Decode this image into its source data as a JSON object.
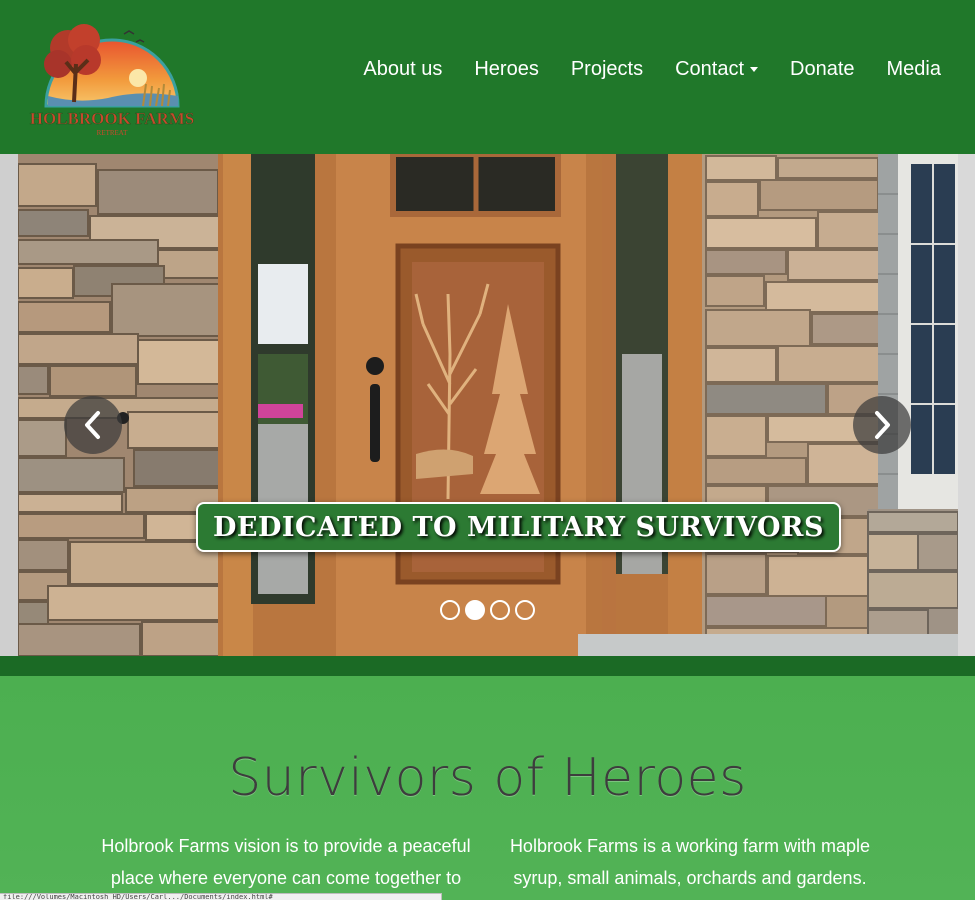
{
  "brand": {
    "logo_text": "HOLBROOK FARMS",
    "logo_subtext": "RETREAT",
    "colors": {
      "nav_bg": "#20782a",
      "section_bg": "#4caf50",
      "caption_bg": "#2c7a33"
    }
  },
  "nav": {
    "items": [
      {
        "label": "About us"
      },
      {
        "label": "Heroes"
      },
      {
        "label": "Projects"
      },
      {
        "label": "Contact"
      },
      {
        "label": "Donate"
      },
      {
        "label": "Media"
      }
    ],
    "dropdown_icon": "caret-down-icon"
  },
  "carousel": {
    "caption": "DEDICATED TO MILITARY SURVIVORS",
    "slide_count": 4,
    "active_index": 1,
    "prev_icon": "chevron-left-icon",
    "next_icon": "chevron-right-icon"
  },
  "main": {
    "title": "Survivors of Heroes",
    "paragraph_left": "Holbrook Farms vision is to provide a peaceful place where everyone can come together to",
    "paragraph_right": "Holbrook Farms is a working farm with maple syrup, small animals, orchards and gardens."
  },
  "status_bar": {
    "text": "file:///Volumes/Macintosh HD/Users/Carl.../Documents/index.html#"
  }
}
